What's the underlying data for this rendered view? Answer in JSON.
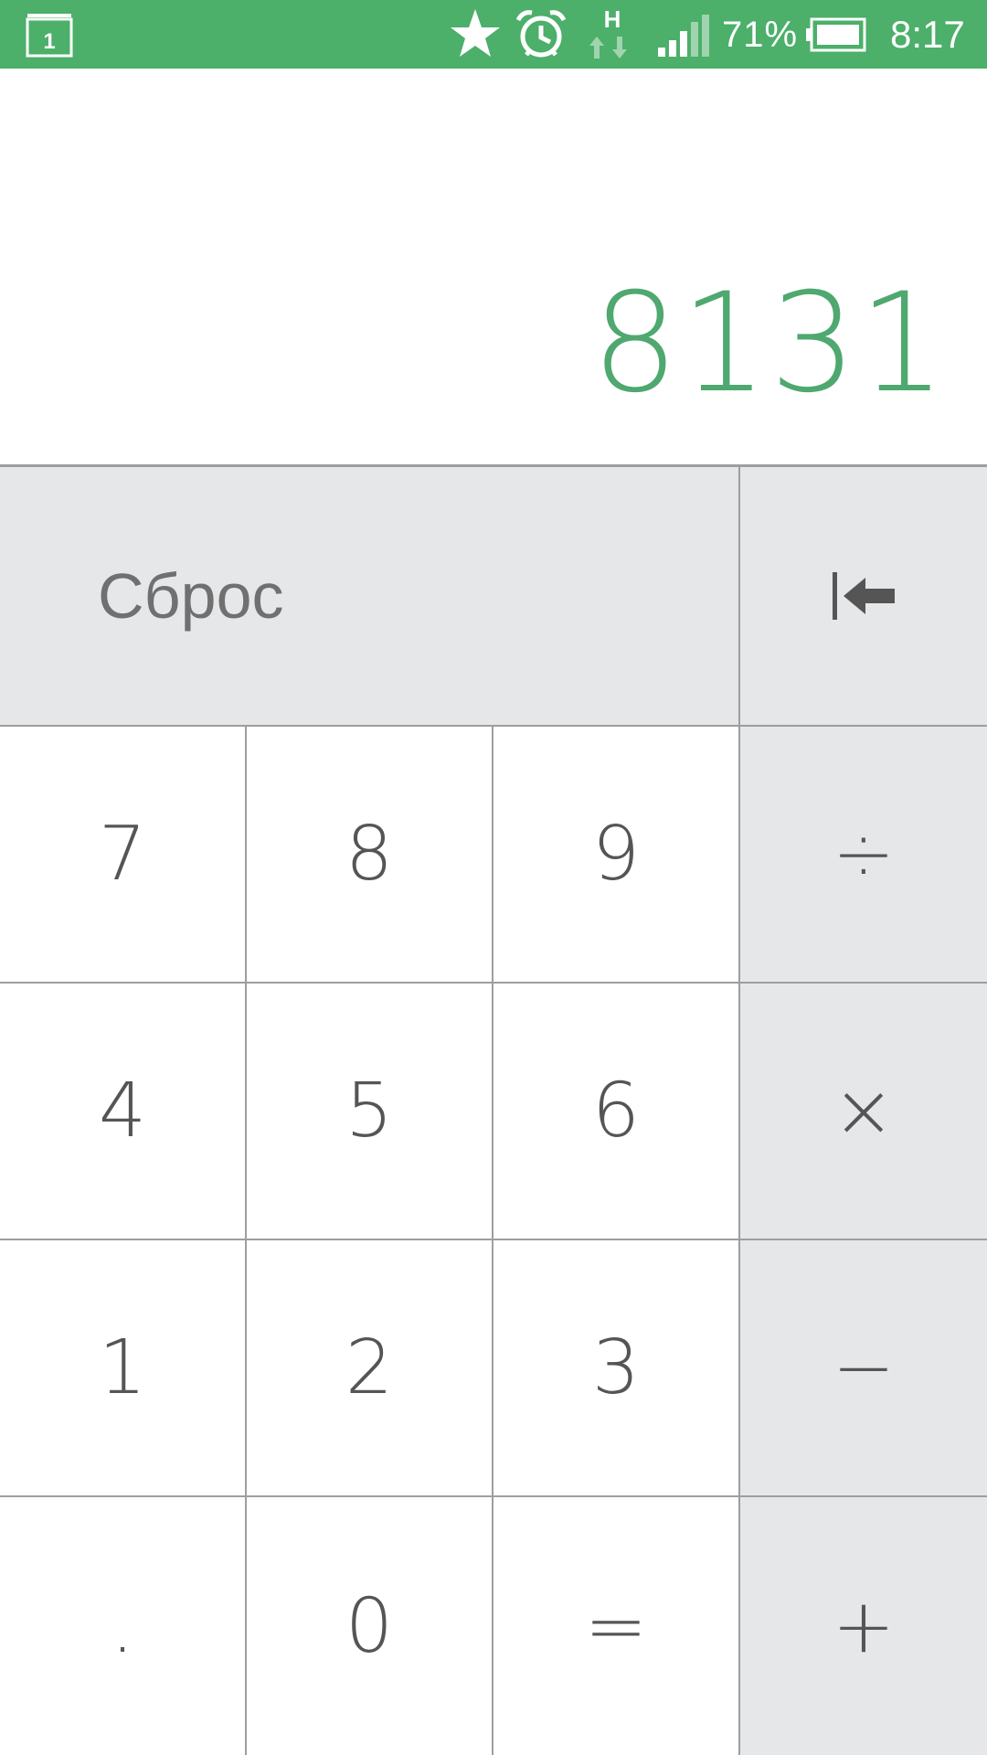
{
  "status_bar": {
    "calendar_day": "1",
    "network_type": "H",
    "battery_percent": "71%",
    "time": "8:17",
    "icons": [
      "calendar-icon",
      "star-icon",
      "alarm-icon",
      "network-h-icon",
      "signal-icon",
      "battery-icon"
    ],
    "background_color": "#4caf6a"
  },
  "display": {
    "value": "8131",
    "value_color": "#4fa870"
  },
  "keypad": {
    "clear_label": "Сброс",
    "backspace_icon": "backspace-icon",
    "keys": {
      "k7": "7",
      "k8": "8",
      "k9": "9",
      "divide": "÷",
      "k4": "4",
      "k5": "5",
      "k6": "6",
      "multiply": "×",
      "k1": "1",
      "k2": "2",
      "k3": "3",
      "minus": "−",
      "dot": ".",
      "k0": "0",
      "equals": "=",
      "plus": "+"
    },
    "operator_background": "#e6e7e9"
  }
}
